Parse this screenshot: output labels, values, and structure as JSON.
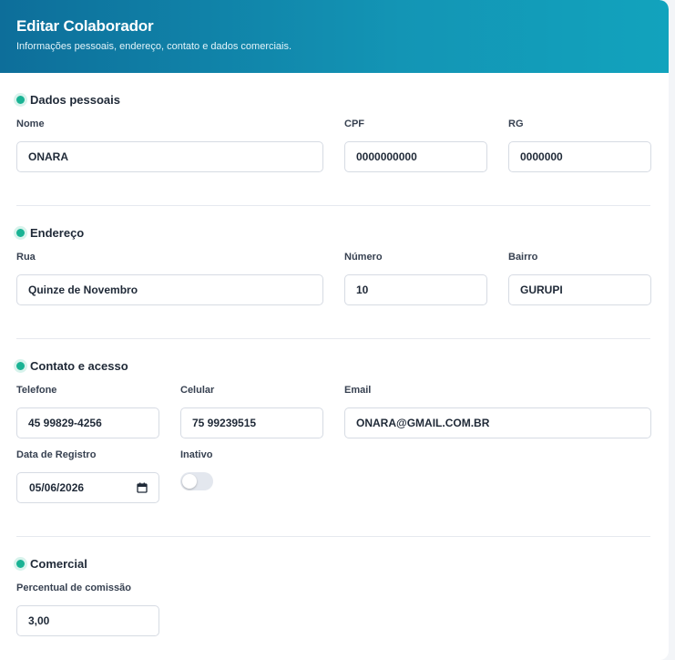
{
  "header": {
    "title": "Editar Colaborador",
    "subtitle": "Informações pessoais, endereço, contato e dados comerciais."
  },
  "sections": {
    "pessoais": {
      "title": "Dados pessoais",
      "nome": {
        "label": "Nome",
        "value": "ONARA"
      },
      "cpf": {
        "label": "CPF",
        "value": "0000000000"
      },
      "rg": {
        "label": "RG",
        "value": "0000000"
      }
    },
    "endereco": {
      "title": "Endereço",
      "rua": {
        "label": "Rua",
        "value": "Quinze de Novembro"
      },
      "numero": {
        "label": "Número",
        "value": "10"
      },
      "bairro": {
        "label": "Bairro",
        "value": "GURUPI"
      }
    },
    "contato": {
      "title": "Contato e acesso",
      "telefone": {
        "label": "Telefone",
        "value": "45 99829-4256"
      },
      "celular": {
        "label": "Celular",
        "value": "75 99239515"
      },
      "email": {
        "label": "Email",
        "value": "ONARA@GMAIL.COM.BR"
      },
      "data_registro": {
        "label": "Data de Registro",
        "value": "05/06/2026"
      },
      "inativo": {
        "label": "Inativo",
        "checked": false
      }
    },
    "comercial": {
      "title": "Comercial",
      "comissao": {
        "label": "Percentual de comissão",
        "value": "3,00"
      }
    }
  },
  "colors": {
    "header_start": "#0d6e9a",
    "header_end": "#12a3bd",
    "accent_dot": "#1ab394"
  },
  "icons": {
    "section_marker": "dot-icon",
    "date_picker": "calendar-icon"
  }
}
